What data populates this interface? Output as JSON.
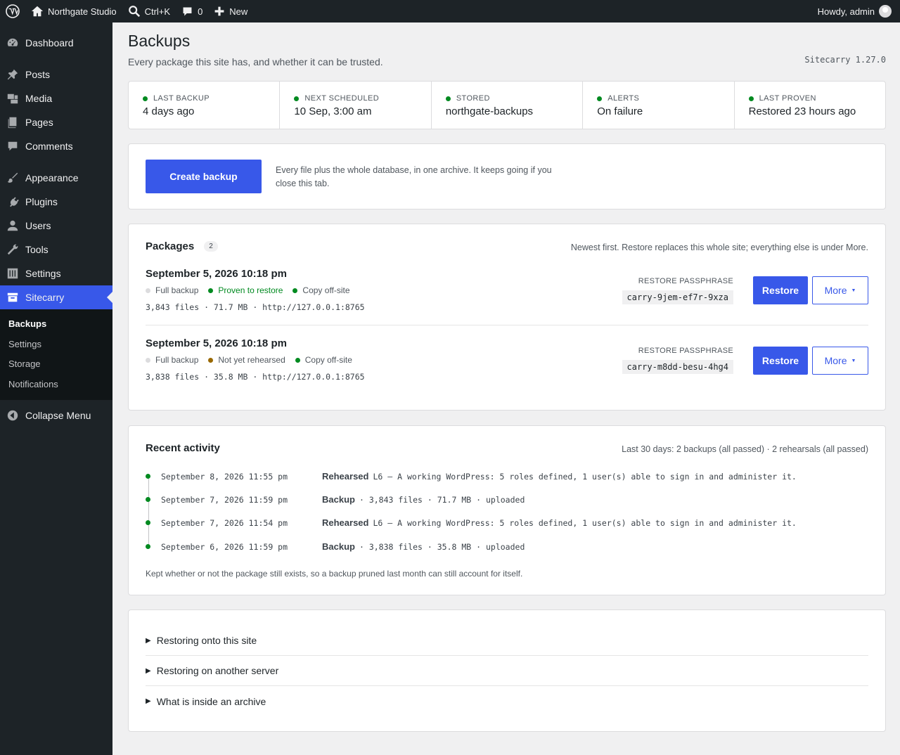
{
  "admin_bar": {
    "site_name": "Northgate Studio",
    "search_shortcut": "Ctrl+K",
    "comments_count": "0",
    "new_label": "New",
    "howdy": "Howdy, admin"
  },
  "sidebar": {
    "items": [
      {
        "label": "Dashboard",
        "icon": "dashboard-icon"
      },
      {
        "label": "Posts",
        "icon": "pin-icon"
      },
      {
        "label": "Media",
        "icon": "media-icon"
      },
      {
        "label": "Pages",
        "icon": "pages-icon"
      },
      {
        "label": "Comments",
        "icon": "comment-icon"
      },
      {
        "label": "Appearance",
        "icon": "brush-icon"
      },
      {
        "label": "Plugins",
        "icon": "plugin-icon"
      },
      {
        "label": "Users",
        "icon": "user-icon"
      },
      {
        "label": "Tools",
        "icon": "wrench-icon"
      },
      {
        "label": "Settings",
        "icon": "settings-icon"
      },
      {
        "label": "Sitecarry",
        "icon": "archive-icon"
      }
    ],
    "submenu": [
      "Backups",
      "Settings",
      "Storage",
      "Notifications"
    ],
    "collapse": "Collapse Menu"
  },
  "page": {
    "title": "Backups",
    "subtitle": "Every package this site has, and whether it can be trusted.",
    "version": "Sitecarry 1.27.0"
  },
  "stats": [
    {
      "label": "LAST BACKUP",
      "value": "4 days ago"
    },
    {
      "label": "NEXT SCHEDULED",
      "value": "10 Sep, 3:00 am"
    },
    {
      "label": "STORED",
      "value": "northgate-backups"
    },
    {
      "label": "ALERTS",
      "value": "On failure"
    },
    {
      "label": "LAST PROVEN",
      "value": "Restored 23 hours ago"
    }
  ],
  "create": {
    "button": "Create backup",
    "description": "Every file plus the whole database, in one archive. It keeps going if you close this tab."
  },
  "packages": {
    "title": "Packages",
    "count": "2",
    "note": "Newest first. Restore replaces this whole site; everything else is under More.",
    "passphrase_label": "RESTORE PASSPHRASE",
    "restore_label": "Restore",
    "more_label": "More",
    "items": [
      {
        "date": "September 5, 2026 10:18 pm",
        "type": "Full backup",
        "status": "Proven to restore",
        "status_color": "#008a20",
        "offsite": "Copy off-site",
        "meta": "3,843 files · 71.7 MB · http://127.0.0.1:8765",
        "passphrase": "carry-9jem-ef7r-9xza"
      },
      {
        "date": "September 5, 2026 10:18 pm",
        "type": "Full backup",
        "status": "Not yet rehearsed",
        "status_color": "#996800",
        "offsite": "Copy off-site",
        "meta": "3,838 files · 35.8 MB · http://127.0.0.1:8765",
        "passphrase": "carry-m8dd-besu-4hg4"
      }
    ]
  },
  "activity": {
    "title": "Recent activity",
    "summary": "Last 30 days: 2 backups (all passed) · 2 rehearsals (all passed)",
    "items": [
      {
        "time": "September 8, 2026 11:55 pm",
        "kind": "Rehearsed",
        "detail": "L6 — A working WordPress: 5 roles defined, 1 user(s) able to sign in and administer it."
      },
      {
        "time": "September 7, 2026 11:59 pm",
        "kind": "Backup",
        "detail": "· 3,843 files · 71.7 MB · uploaded"
      },
      {
        "time": "September 7, 2026 11:54 pm",
        "kind": "Rehearsed",
        "detail": "L6 — A working WordPress: 5 roles defined, 1 user(s) able to sign in and administer it."
      },
      {
        "time": "September 6, 2026 11:59 pm",
        "kind": "Backup",
        "detail": "· 3,838 files · 35.8 MB · uploaded"
      }
    ],
    "footnote": "Kept whether or not the package still exists, so a backup pruned last month can still account for itself."
  },
  "help": [
    "Restoring onto this site",
    "Restoring on another server",
    "What is inside an archive"
  ]
}
